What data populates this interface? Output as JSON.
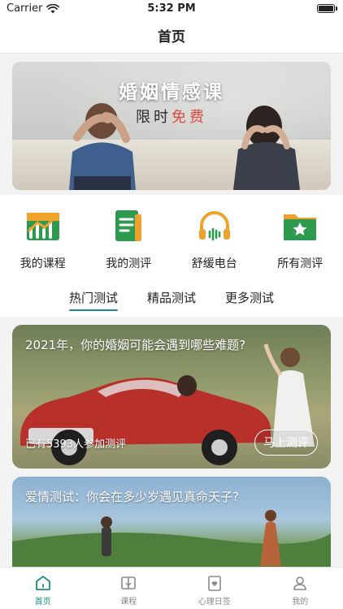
{
  "status_bar": {
    "carrier": "Carrier",
    "time": "5:32 PM"
  },
  "nav": {
    "title": "首页"
  },
  "banner": {
    "title": "婚姻情感课",
    "subtitle_a": "限时",
    "subtitle_b": "免费"
  },
  "quick_menu": [
    {
      "label": "我的课程",
      "icon": "chart-bars-icon"
    },
    {
      "label": "我的测评",
      "icon": "document-list-icon"
    },
    {
      "label": "舒缓电台",
      "icon": "headphones-icon"
    },
    {
      "label": "所有测评",
      "icon": "star-folder-icon"
    }
  ],
  "tabs": [
    {
      "label": "热门测试",
      "active": true
    },
    {
      "label": "精品测试",
      "active": false
    },
    {
      "label": "更多测试",
      "active": false
    }
  ],
  "cards": [
    {
      "title": "2021年，你的婚姻可能会遇到哪些难题?",
      "count_text": "已有5393人参加测评",
      "button": "马上测评"
    },
    {
      "title": "爱情测试：你会在多少岁遇见真命天子?"
    }
  ],
  "tabbar": [
    {
      "label": "首页",
      "icon": "home-icon",
      "active": true
    },
    {
      "label": "课程",
      "icon": "book-icon",
      "active": false
    },
    {
      "label": "心理日签",
      "icon": "heart-calendar-icon",
      "active": false
    },
    {
      "label": "我的",
      "icon": "user-icon",
      "active": false
    }
  ],
  "colors": {
    "accent": "#1f8a8a",
    "green": "#2e9a4e",
    "orange": "#f0a22e",
    "highlight_red": "#e0493e"
  }
}
